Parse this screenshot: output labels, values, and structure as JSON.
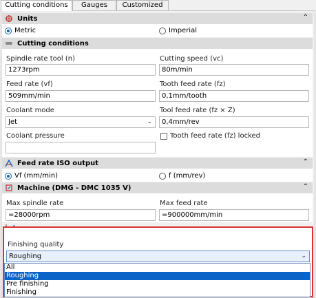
{
  "tabs": [
    "Cutting conditions",
    "Gauges",
    "Customized"
  ],
  "units": {
    "title": "Units",
    "options": [
      "Metric",
      "Imperial"
    ],
    "selected": "Metric"
  },
  "cutting": {
    "title": "Cutting conditions",
    "spindle_label": "Spindle rate tool (n)",
    "spindle_value": "1273rpm",
    "speed_label": "Cutting speed (vc)",
    "speed_value": "80m/min",
    "feed_label": "Feed rate (vf)",
    "feed_value": "509mm/min",
    "tooth_label": "Tooth feed rate (fz)",
    "tooth_value": "0,1mm/tooth",
    "coolant_label": "Coolant mode",
    "coolant_value": "Jet",
    "toolfeed_label": "Tool feed rate (fz × Z)",
    "toolfeed_value": "0,4mm/rev",
    "pressure_label": "Coolant pressure",
    "pressure_value": "",
    "locked_label": "Tooth feed rate (fz) locked"
  },
  "iso": {
    "title": "Feed rate ISO output",
    "options": [
      "Vf (mm/min)",
      "f (mm/rev)"
    ],
    "selected": "Vf (mm/min)"
  },
  "machine": {
    "title": "Machine (DMG - DMC 1035 V)",
    "max_spindle_label": "Max spindle rate",
    "max_spindle_value": "=28000rpm",
    "max_feed_label": "Max feed rate",
    "max_feed_value": "=900000mm/min"
  },
  "finishing": {
    "label": "Finishing quality",
    "selected": "Roughing",
    "options": [
      "All",
      "Roughing",
      "Pre finishing",
      "Finishing"
    ]
  },
  "colors": {
    "accent": "#0a64c8",
    "highlight_border": "#e03030"
  }
}
